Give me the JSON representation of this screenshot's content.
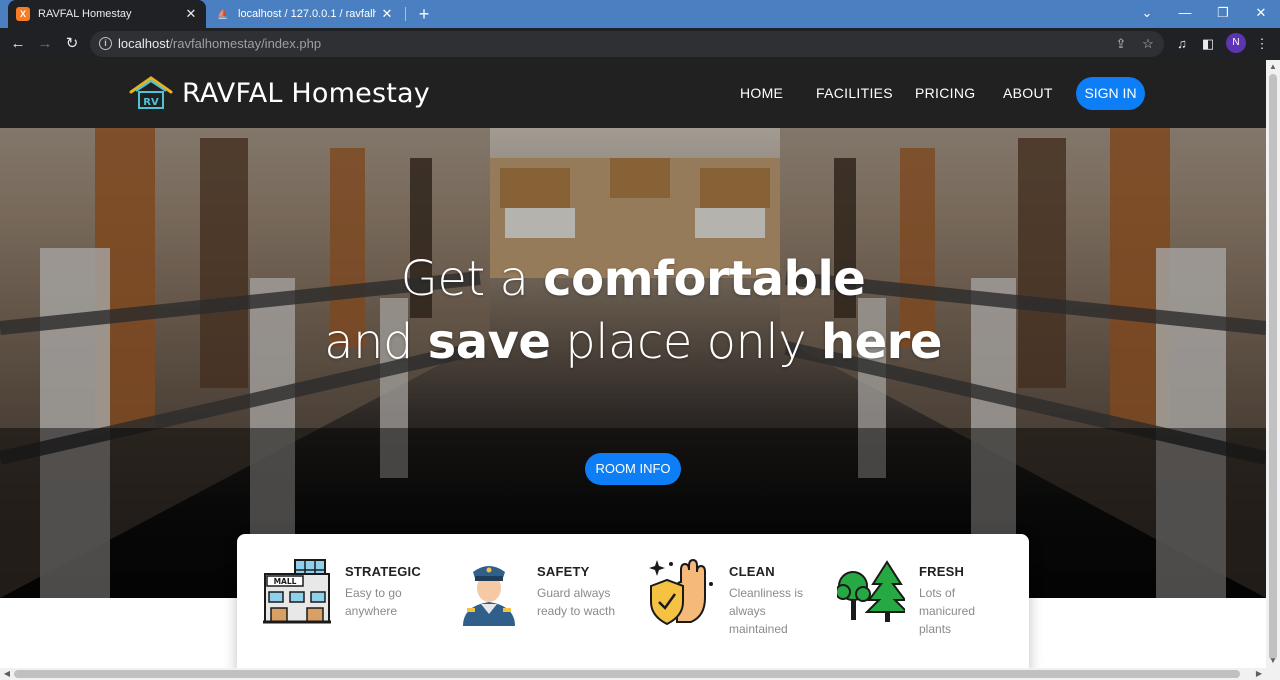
{
  "browser": {
    "tabs": [
      {
        "title": "RAVFAL Homestay",
        "favicon": "xampp-icon",
        "active": true
      },
      {
        "title": "localhost / 127.0.0.1 / ravfalhome",
        "favicon": "phpmyadmin-icon",
        "active": false
      }
    ],
    "new_tab": "+",
    "address": {
      "host": "localhost",
      "path": "/ravfalhomestay/index.php"
    },
    "profile_initial": "N",
    "colors": {
      "tabstrip": "#4a7fc1",
      "toolbar": "#202124"
    }
  },
  "site": {
    "brand": {
      "logo_text": "RV",
      "name": "RAVFAL Homestay"
    },
    "nav": [
      {
        "label": "HOME"
      },
      {
        "label": "FACILITIES"
      },
      {
        "label": "PRICING"
      },
      {
        "label": "ABOUT"
      }
    ],
    "signin_label": "SIGN IN",
    "hero": {
      "line1_light": "Get a ",
      "line1_bold": "comfortable",
      "line2_light_a": "and ",
      "line2_bold_a": "save",
      "line2_light_b": " place only ",
      "line2_bold_b": "here",
      "button_label": "ROOM INFO"
    },
    "features": [
      {
        "icon": "mall-building-icon",
        "icon_label": "MALL",
        "title": "STRATEGIC",
        "description": "Easy to go anywhere"
      },
      {
        "icon": "security-guard-icon",
        "title": "SAFETY",
        "description": "Guard always ready to wacth"
      },
      {
        "icon": "clean-hand-shield-icon",
        "title": "CLEAN",
        "description": "Cleanliness is always maintained"
      },
      {
        "icon": "trees-icon",
        "title": "FRESH",
        "description": "Lots of manicured plants"
      }
    ],
    "colors": {
      "accent": "#0d7ef5",
      "navbar": "#212121"
    }
  }
}
